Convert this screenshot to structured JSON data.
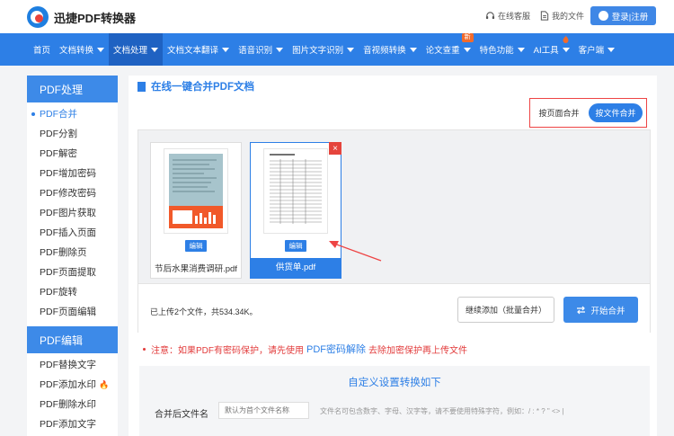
{
  "header": {
    "logo_text": "迅捷PDF转换器",
    "support_label": "在线客服",
    "files_label": "我的文件",
    "login_label": "登录|注册"
  },
  "nav": {
    "items": [
      {
        "label": "首页",
        "caret": false
      },
      {
        "label": "文档转换",
        "caret": true
      },
      {
        "label": "文档处理",
        "caret": true,
        "active": true
      },
      {
        "label": "文档文本翻译",
        "caret": true
      },
      {
        "label": "语音识别",
        "caret": true
      },
      {
        "label": "图片文字识别",
        "caret": true
      },
      {
        "label": "音视频转换",
        "caret": true
      },
      {
        "label": "论文查重",
        "caret": true,
        "badge": "新"
      },
      {
        "label": "特色功能",
        "caret": true
      },
      {
        "label": "AI工具",
        "caret": true,
        "hot": true
      },
      {
        "label": "客户端",
        "caret": true
      }
    ]
  },
  "sidebar": {
    "section1_title": "PDF处理",
    "section1_items": [
      "PDF合并",
      "PDF分割",
      "PDF解密",
      "PDF增加密码",
      "PDF修改密码",
      "PDF图片获取",
      "PDF插入页面",
      "PDF删除页",
      "PDF页面提取",
      "PDF旋转",
      "PDF页面编辑"
    ],
    "section2_title": "PDF编辑",
    "section2_items": [
      "PDF替换文字",
      "PDF添加水印",
      "PDF删除水印",
      "PDF添加文字"
    ]
  },
  "main": {
    "title": "在线一键合并PDF文档",
    "mode_page": "按页面合并",
    "mode_file": "按文件合并",
    "files": [
      {
        "name": "节后水果消费调研.pdf",
        "edit": "编辑"
      },
      {
        "name": "供货单.pdf",
        "edit": "编辑"
      }
    ],
    "upload_info": "已上传2个文件，共534.34K。",
    "add_button": "继续添加（批量合并）",
    "merge_button": "开始合并",
    "notice_prefix": "注意：如果PDF有密码保护，请先使用",
    "notice_link": "PDF密码解除",
    "notice_suffix": "去除加密保护再上传文件",
    "settings_title": "自定义设置转换如下",
    "filename_label": "合并后文件名",
    "filename_placeholder": "默认为首个文件名称",
    "filename_hint": "文件名可包含数字、字母、汉字等，请不要使用特殊字符，例如：/ : * ? \" <> |"
  },
  "colors": {
    "brand_blue": "#2d7fe6",
    "nav_active": "#1f62c2",
    "alert_red": "#e23b3b"
  }
}
